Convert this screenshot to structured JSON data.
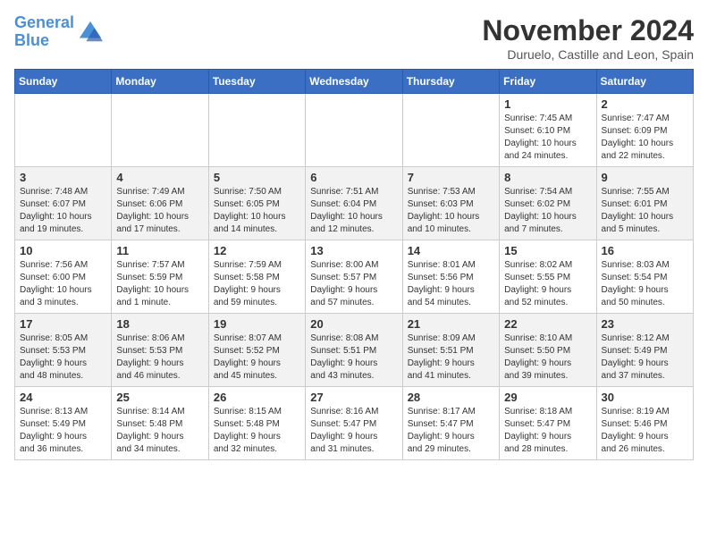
{
  "header": {
    "logo_line1": "General",
    "logo_line2": "Blue",
    "month_title": "November 2024",
    "subtitle": "Duruelo, Castille and Leon, Spain"
  },
  "days_of_week": [
    "Sunday",
    "Monday",
    "Tuesday",
    "Wednesday",
    "Thursday",
    "Friday",
    "Saturday"
  ],
  "weeks": [
    [
      {
        "day": "",
        "detail": ""
      },
      {
        "day": "",
        "detail": ""
      },
      {
        "day": "",
        "detail": ""
      },
      {
        "day": "",
        "detail": ""
      },
      {
        "day": "",
        "detail": ""
      },
      {
        "day": "1",
        "detail": "Sunrise: 7:45 AM\nSunset: 6:10 PM\nDaylight: 10 hours\nand 24 minutes."
      },
      {
        "day": "2",
        "detail": "Sunrise: 7:47 AM\nSunset: 6:09 PM\nDaylight: 10 hours\nand 22 minutes."
      }
    ],
    [
      {
        "day": "3",
        "detail": "Sunrise: 7:48 AM\nSunset: 6:07 PM\nDaylight: 10 hours\nand 19 minutes."
      },
      {
        "day": "4",
        "detail": "Sunrise: 7:49 AM\nSunset: 6:06 PM\nDaylight: 10 hours\nand 17 minutes."
      },
      {
        "day": "5",
        "detail": "Sunrise: 7:50 AM\nSunset: 6:05 PM\nDaylight: 10 hours\nand 14 minutes."
      },
      {
        "day": "6",
        "detail": "Sunrise: 7:51 AM\nSunset: 6:04 PM\nDaylight: 10 hours\nand 12 minutes."
      },
      {
        "day": "7",
        "detail": "Sunrise: 7:53 AM\nSunset: 6:03 PM\nDaylight: 10 hours\nand 10 minutes."
      },
      {
        "day": "8",
        "detail": "Sunrise: 7:54 AM\nSunset: 6:02 PM\nDaylight: 10 hours\nand 7 minutes."
      },
      {
        "day": "9",
        "detail": "Sunrise: 7:55 AM\nSunset: 6:01 PM\nDaylight: 10 hours\nand 5 minutes."
      }
    ],
    [
      {
        "day": "10",
        "detail": "Sunrise: 7:56 AM\nSunset: 6:00 PM\nDaylight: 10 hours\nand 3 minutes."
      },
      {
        "day": "11",
        "detail": "Sunrise: 7:57 AM\nSunset: 5:59 PM\nDaylight: 10 hours\nand 1 minute."
      },
      {
        "day": "12",
        "detail": "Sunrise: 7:59 AM\nSunset: 5:58 PM\nDaylight: 9 hours\nand 59 minutes."
      },
      {
        "day": "13",
        "detail": "Sunrise: 8:00 AM\nSunset: 5:57 PM\nDaylight: 9 hours\nand 57 minutes."
      },
      {
        "day": "14",
        "detail": "Sunrise: 8:01 AM\nSunset: 5:56 PM\nDaylight: 9 hours\nand 54 minutes."
      },
      {
        "day": "15",
        "detail": "Sunrise: 8:02 AM\nSunset: 5:55 PM\nDaylight: 9 hours\nand 52 minutes."
      },
      {
        "day": "16",
        "detail": "Sunrise: 8:03 AM\nSunset: 5:54 PM\nDaylight: 9 hours\nand 50 minutes."
      }
    ],
    [
      {
        "day": "17",
        "detail": "Sunrise: 8:05 AM\nSunset: 5:53 PM\nDaylight: 9 hours\nand 48 minutes."
      },
      {
        "day": "18",
        "detail": "Sunrise: 8:06 AM\nSunset: 5:53 PM\nDaylight: 9 hours\nand 46 minutes."
      },
      {
        "day": "19",
        "detail": "Sunrise: 8:07 AM\nSunset: 5:52 PM\nDaylight: 9 hours\nand 45 minutes."
      },
      {
        "day": "20",
        "detail": "Sunrise: 8:08 AM\nSunset: 5:51 PM\nDaylight: 9 hours\nand 43 minutes."
      },
      {
        "day": "21",
        "detail": "Sunrise: 8:09 AM\nSunset: 5:51 PM\nDaylight: 9 hours\nand 41 minutes."
      },
      {
        "day": "22",
        "detail": "Sunrise: 8:10 AM\nSunset: 5:50 PM\nDaylight: 9 hours\nand 39 minutes."
      },
      {
        "day": "23",
        "detail": "Sunrise: 8:12 AM\nSunset: 5:49 PM\nDaylight: 9 hours\nand 37 minutes."
      }
    ],
    [
      {
        "day": "24",
        "detail": "Sunrise: 8:13 AM\nSunset: 5:49 PM\nDaylight: 9 hours\nand 36 minutes."
      },
      {
        "day": "25",
        "detail": "Sunrise: 8:14 AM\nSunset: 5:48 PM\nDaylight: 9 hours\nand 34 minutes."
      },
      {
        "day": "26",
        "detail": "Sunrise: 8:15 AM\nSunset: 5:48 PM\nDaylight: 9 hours\nand 32 minutes."
      },
      {
        "day": "27",
        "detail": "Sunrise: 8:16 AM\nSunset: 5:47 PM\nDaylight: 9 hours\nand 31 minutes."
      },
      {
        "day": "28",
        "detail": "Sunrise: 8:17 AM\nSunset: 5:47 PM\nDaylight: 9 hours\nand 29 minutes."
      },
      {
        "day": "29",
        "detail": "Sunrise: 8:18 AM\nSunset: 5:47 PM\nDaylight: 9 hours\nand 28 minutes."
      },
      {
        "day": "30",
        "detail": "Sunrise: 8:19 AM\nSunset: 5:46 PM\nDaylight: 9 hours\nand 26 minutes."
      }
    ]
  ]
}
